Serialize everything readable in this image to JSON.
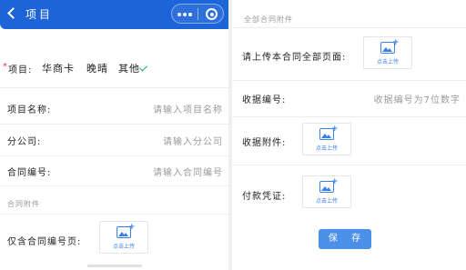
{
  "header": {
    "title": "项目",
    "back_icon": "chevron-left-icon",
    "more_icon": "more-dots-icon",
    "close_icon": "target-circle-icon",
    "color": "#1d64d8"
  },
  "form": {
    "project_type": {
      "required_mark": "*",
      "label": "项目:",
      "options": [
        "华商卡",
        "晚晴",
        "其他"
      ],
      "selected": "其他"
    },
    "fields": [
      {
        "label": "项目名称:",
        "placeholder": "请输入项目名称"
      },
      {
        "label": "分公司:",
        "placeholder": "请输入分公司"
      },
      {
        "label": "合同编号:",
        "placeholder": "请输入合同编号"
      }
    ],
    "attachment_section": "合同附件",
    "contract_number_page": {
      "label": "仅含合同编号页:"
    }
  },
  "right": {
    "section": "全部合同附件",
    "all_pages": {
      "label": "请上传本合同全部页面:"
    },
    "receipt_number": {
      "label": "收据编号:",
      "placeholder": "收据编号为7位数字"
    },
    "receipt_attachment": {
      "label": "收据附件:"
    },
    "payment_voucher": {
      "label": "付款凭证:"
    }
  },
  "upload_label": "点击上传",
  "save_label": "保 存",
  "colors": {
    "accent": "#1d64d8",
    "button": "#4a8fe8",
    "upload": "#3a7fe6",
    "check": "#1aad5c",
    "required": "#e03c3c"
  }
}
